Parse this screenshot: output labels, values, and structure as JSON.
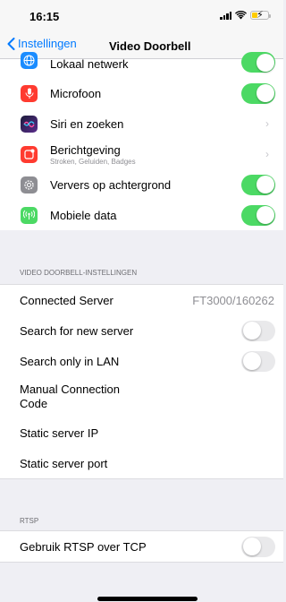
{
  "status": {
    "time": "16:15"
  },
  "nav": {
    "back_label": "Instellingen",
    "title": "Video Doorbell"
  },
  "permissions": [
    {
      "label": "Lokaal netwerk",
      "icon": "globe-icon",
      "color": "#1a8cff",
      "control": "toggle",
      "state": "on"
    },
    {
      "label": "Microfoon",
      "icon": "microphone-icon",
      "color": "#ff3b30",
      "control": "toggle",
      "state": "on"
    },
    {
      "label": "Siri en zoeken",
      "icon": "siri-icon",
      "color": "#2c2c54",
      "control": "chevron"
    },
    {
      "label": "Berichtgeving",
      "sublabel": "Stroken, Geluiden, Badges",
      "icon": "notification-icon",
      "color": "#ff3b30",
      "control": "chevron"
    },
    {
      "label": "Ververs op achtergrond",
      "icon": "gear-icon",
      "color": "#8e8e93",
      "control": "toggle",
      "state": "on"
    },
    {
      "label": "Mobiele data",
      "icon": "antenna-icon",
      "color": "#4cd964",
      "control": "toggle",
      "state": "on"
    }
  ],
  "doorbell": {
    "header": "VIDEO DOORBELL-INSTELLINGEN",
    "connected_server_label": "Connected Server",
    "connected_server_value": "FT3000/160262",
    "search_new_label": "Search for new server",
    "search_lan_label": "Search only in LAN",
    "manual_code_label_line1": "Manual Connection",
    "manual_code_label_line2": "Code",
    "static_ip_label": "Static server IP",
    "static_port_label": "Static server port"
  },
  "rtsp": {
    "header": "RTSP",
    "tcp_label": "Gebruik RTSP over TCP"
  },
  "colors": {
    "accent": "#007aff",
    "toggle_on": "#4cd964",
    "toggle_off": "#e9e9eb"
  }
}
